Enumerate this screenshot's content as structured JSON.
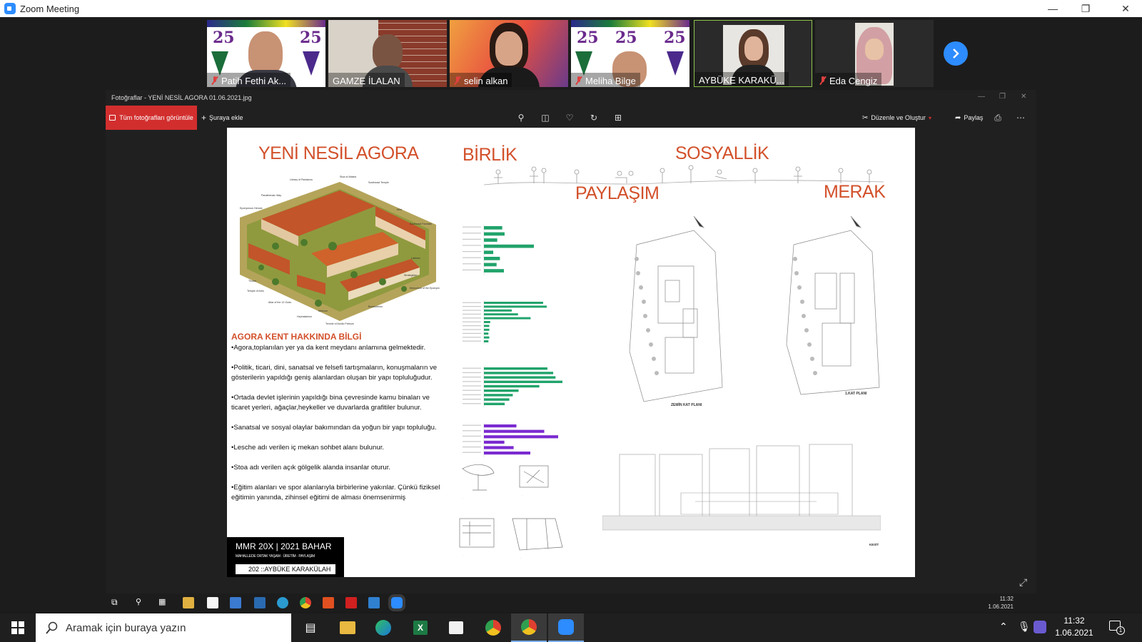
{
  "window": {
    "title": "Zoom Meeting"
  },
  "participants": [
    {
      "name": "Patih Fethi Ak...",
      "muted": true
    },
    {
      "name": "GAMZE İLALAN",
      "muted": false
    },
    {
      "name": "selin alkan",
      "muted": true
    },
    {
      "name": "Meliha Bilge",
      "muted": true
    },
    {
      "name": "AYBÜKE KARAKÜ...",
      "muted": false
    },
    {
      "name": "Eda Cengiz",
      "muted": true
    }
  ],
  "banner_number": "25",
  "photos_app": {
    "title": "Fotoğraflar - YENİ NESİL AGORA 01.06.2021.jpg",
    "view_all": "Tüm fotoğrafları görüntüle",
    "add_to": "Şuraya ekle",
    "edit_create": "Düzenle ve Oluştur",
    "share": "Paylaş"
  },
  "poster": {
    "title": "YENİ NESİL AGORA",
    "word_unity": "BİRLİK",
    "word_social": "SOSYALLİK",
    "word_sharing": "PAYLAŞIM",
    "word_curiosity": "MERAK",
    "info_heading": "AGORA KENT HAKKINDA BİLGİ",
    "bullets": [
      "•Agora,toplanılan yer ya da kent meydanı anlamına gelmektedir.",
      "•Politik, ticari, dini, sanatsal ve felsefi tartışmaların, konuşmaların ve gösterilerin yapıldığı geniş alanlardan oluşan bir yapı topluluğudur.",
      "•Ortada devlet işlerinin yapıldığı bina çevresinde kamu binaları ve ticaret yerleri, ağaçlar,heykeller ve duvarlarda grafitiler bulunur.",
      "•Sanatsal ve sosyal olaylar bakımından da yoğun bir yapı topluluğu.",
      "•Lesche adı verilen iç mekan sohbet alanı bulunur.",
      "•Stoa adı verilen açık gölgelik alanda insanlar oturur.",
      "•Eğitim alanları ve spor alanlarıyla birbirlerine yakınlar. Çünkü fiziksel eğitimin yanında, zihinsel eğitimi de alması önemsenirmiş"
    ],
    "course_code": "MMR 20X | 2021 BAHAR",
    "course_subtitle": "MAHALLEDE ORTAK YAŞAM · ÜRETİM · PAYLAŞIM",
    "student": "202 ::AYBÜKE KARAKÜLAH",
    "ground_plan_label": "ZEMİN KAT PLANI",
    "first_plan_label": "1.KAT PLANI",
    "section_label": "KESİT"
  },
  "inner_clock": {
    "time": "11:32",
    "date": "1.06.2021"
  },
  "taskbar": {
    "search_placeholder": "Aramak için buraya yazın",
    "time": "11:32",
    "date": "1.06.2021",
    "notifications": "1"
  },
  "colors": {
    "accent_orange": "#d2502a",
    "chart_green": "#21a36b",
    "chart_purple": "#7a2ad0",
    "zoom_blue": "#2d8cff"
  },
  "chart_data": [
    {
      "type": "bar",
      "categories": [
        "1",
        "2",
        "3",
        "4",
        "5",
        "6",
        "7",
        "8"
      ],
      "values": [
        55,
        62,
        40,
        150,
        28,
        48,
        38,
        60
      ],
      "title": ""
    },
    {
      "type": "bar",
      "categories": [
        "1",
        "2",
        "3",
        "4",
        "5",
        "6",
        "7",
        "8",
        "9",
        "10",
        "11"
      ],
      "values": [
        66,
        70,
        31,
        38,
        52,
        7,
        6,
        6,
        5,
        6,
        5
      ],
      "title": ""
    },
    {
      "type": "bar",
      "categories": [
        "1",
        "2",
        "3",
        "4",
        "5",
        "6",
        "7",
        "8",
        "9"
      ],
      "values": [
        55,
        60,
        62,
        68,
        48,
        30,
        25,
        22,
        18
      ],
      "title": ""
    },
    {
      "type": "bar",
      "categories": [
        "1",
        "2",
        "3",
        "4",
        "5",
        "6"
      ],
      "values": [
        35,
        65,
        80,
        22,
        32,
        50
      ],
      "title": ""
    }
  ]
}
